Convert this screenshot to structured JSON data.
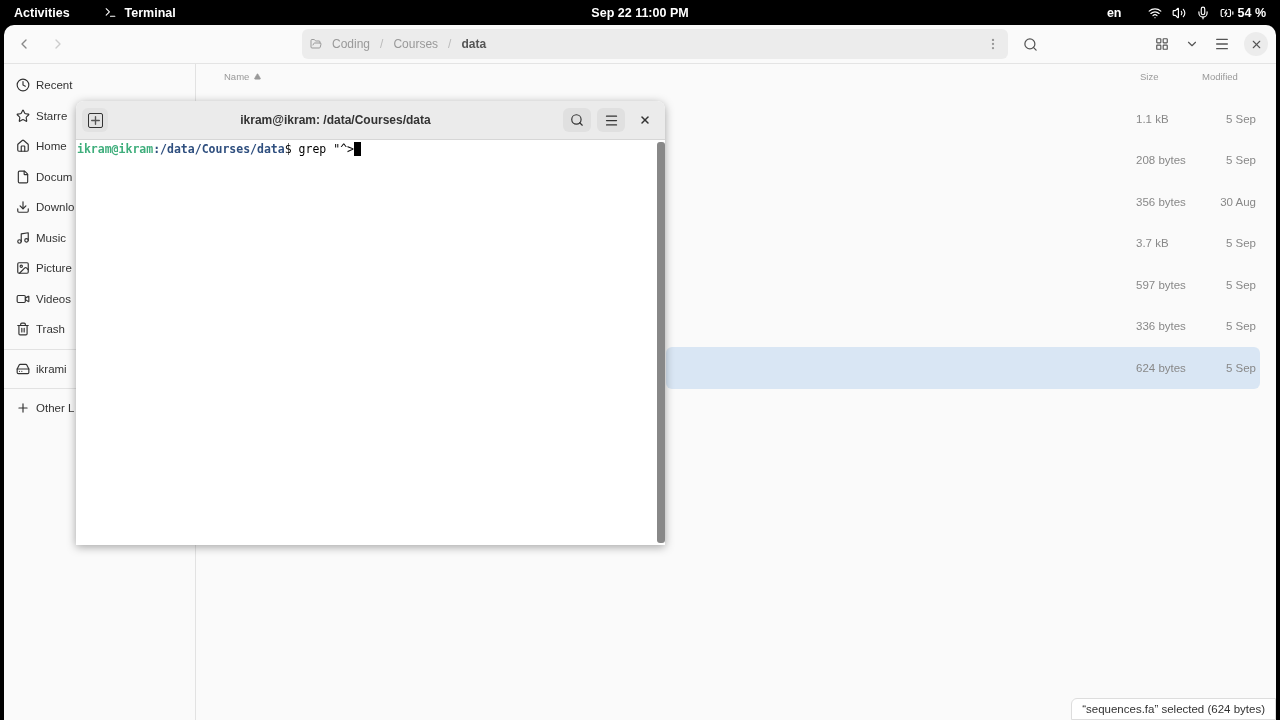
{
  "top_bar": {
    "activities": "Activities",
    "app": "Terminal",
    "clock": "Sep 22  11:00 PM",
    "language": "en",
    "battery": "54 %"
  },
  "file_manager": {
    "breadcrumbs": [
      "Coding",
      "Courses",
      "data"
    ],
    "breadcrumb_separator": "/",
    "sidebar": {
      "places": [
        {
          "label": "Recent",
          "kind": "recent"
        },
        {
          "label": "Starre",
          "kind": "starred"
        },
        {
          "label": "Home",
          "kind": "home"
        },
        {
          "label": "Docum",
          "kind": "documents"
        },
        {
          "label": "Downlo",
          "kind": "downloads"
        },
        {
          "label": "Music",
          "kind": "music"
        },
        {
          "label": "Picture",
          "kind": "pictures"
        },
        {
          "label": "Videos",
          "kind": "videos"
        },
        {
          "label": "Trash",
          "kind": "trash"
        }
      ],
      "devices": [
        {
          "label": "ikrami",
          "kind": "drive"
        }
      ],
      "other": [
        {
          "label": "Other L",
          "kind": "other"
        }
      ]
    },
    "columns": {
      "name": "Name",
      "size": "Size",
      "modified": "Modified"
    },
    "rows": [
      {
        "size": "1.1 kB",
        "modified": "5 Sep",
        "selected": false
      },
      {
        "size": "208 bytes",
        "modified": "5 Sep",
        "selected": false
      },
      {
        "size": "356 bytes",
        "modified": "30 Aug",
        "selected": false
      },
      {
        "size": "3.7 kB",
        "modified": "5 Sep",
        "selected": false
      },
      {
        "size": "597 bytes",
        "modified": "5 Sep",
        "selected": false
      },
      {
        "size": "336 bytes",
        "modified": "5 Sep",
        "selected": false
      },
      {
        "size": "624 bytes",
        "modified": "5 Sep",
        "selected": true
      }
    ],
    "status": "“sequences.fa” selected  (624 bytes)"
  },
  "terminal": {
    "title": "ikram@ikram: /data/Courses/data",
    "prompt_user": "ikram@ikram",
    "prompt_path": ":/data/Courses/data",
    "prompt_sign": "$",
    "command": " grep \"^>"
  }
}
